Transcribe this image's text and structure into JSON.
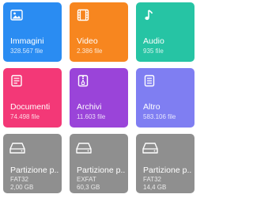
{
  "tiles": [
    {
      "title": "Immagini",
      "sub": "328.567 file",
      "icon": "image-icon",
      "color": "#2a8cf2"
    },
    {
      "title": "Video",
      "sub": "2.386 file",
      "icon": "film-icon",
      "color": "#f7861f"
    },
    {
      "title": "Audio",
      "sub": "935 file",
      "icon": "music-note-icon",
      "color": "#26c4a4"
    },
    {
      "title": "Documenti",
      "sub": "74.498 file",
      "icon": "document-icon",
      "color": "#f33877"
    },
    {
      "title": "Archivi",
      "sub": "11.603 file",
      "icon": "archive-icon",
      "color": "#9a44d9"
    },
    {
      "title": "Altro",
      "sub": "583.106 file",
      "icon": "file-icon",
      "color": "#7f7ef2"
    }
  ],
  "drives": [
    {
      "title": "Partizione p...",
      "fs": "FAT32",
      "size": "2,00 GB",
      "icon": "hard-drive-icon",
      "color": "#8f8f8f"
    },
    {
      "title": "Partizione p...",
      "fs": "EXFAT",
      "size": "60,3 GB",
      "icon": "hard-drive-icon",
      "color": "#8f8f8f"
    },
    {
      "title": "Partizione p...",
      "fs": "FAT32",
      "size": "14,4 GB",
      "icon": "hard-drive-icon",
      "color": "#8f8f8f"
    }
  ]
}
